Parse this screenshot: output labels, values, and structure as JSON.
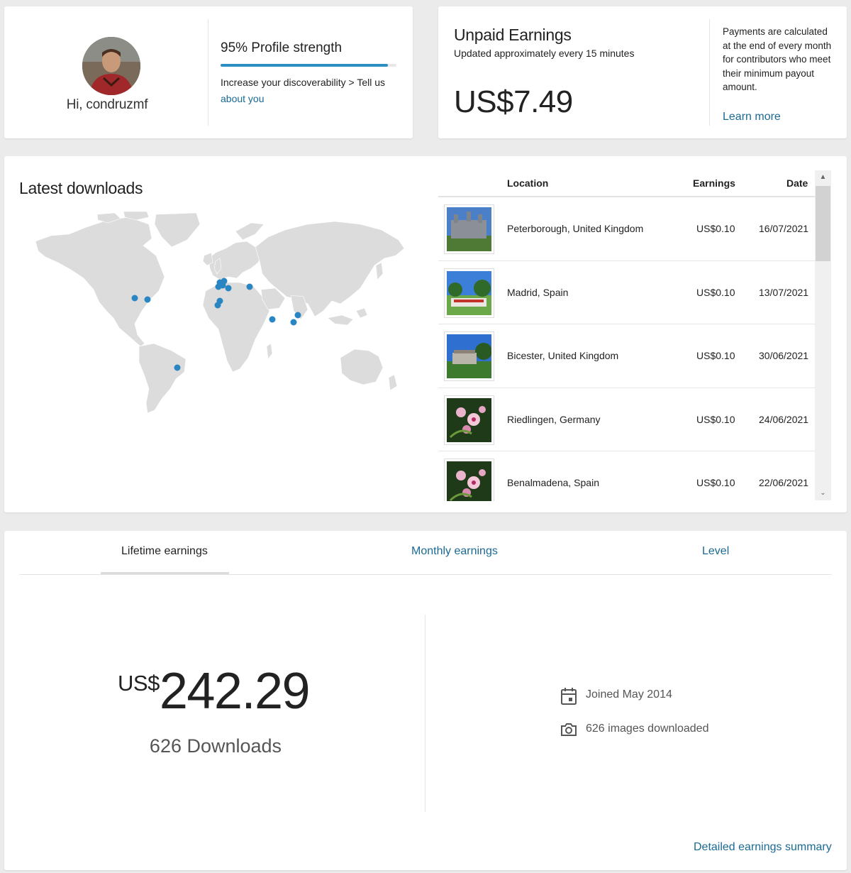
{
  "profile": {
    "greeting": "Hi, condruzmf",
    "strength_label": "95% Profile strength",
    "strength_percent": 95,
    "hint_text": "Increase your discoverability > Tell us",
    "hint_link": "about you"
  },
  "unpaid": {
    "title": "Unpaid Earnings",
    "subtitle": "Updated approximately every 15 minutes",
    "amount": "US$7.49",
    "note": "Payments are calculated at the end of every month for contributors who meet their minimum payout amount.",
    "learn_more": "Learn more"
  },
  "downloads": {
    "title": "Latest downloads",
    "columns": {
      "location": "Location",
      "earnings": "Earnings",
      "date": "Date"
    },
    "rows": [
      {
        "location": "Peterborough, United Kingdom",
        "earnings": "US$0.10",
        "date": "16/07/2021",
        "thumb": "building-icon"
      },
      {
        "location": "Madrid, Spain",
        "earnings": "US$0.10",
        "date": "13/07/2021",
        "thumb": "park-icon"
      },
      {
        "location": "Bicester, United Kingdom",
        "earnings": "US$0.10",
        "date": "30/06/2021",
        "thumb": "mansion-icon"
      },
      {
        "location": "Riedlingen, Germany",
        "earnings": "US$0.10",
        "date": "24/06/2021",
        "thumb": "flower-icon"
      },
      {
        "location": "Benalmadena, Spain",
        "earnings": "US$0.10",
        "date": "22/06/2021",
        "thumb": "flower-icon"
      }
    ],
    "marker_color": "#2a86c2"
  },
  "lifetime": {
    "tabs": [
      "Lifetime earnings",
      "Monthly earnings",
      "Level"
    ],
    "active_tab": "Lifetime earnings",
    "currency": "US$",
    "amount": "242.29",
    "downloads": "626 Downloads",
    "joined": "Joined May 2014",
    "images_downloaded": "626 images downloaded",
    "summary_link": "Detailed earnings summary"
  },
  "colors": {
    "accent": "#2d8ec4",
    "link": "#1a6a94"
  }
}
